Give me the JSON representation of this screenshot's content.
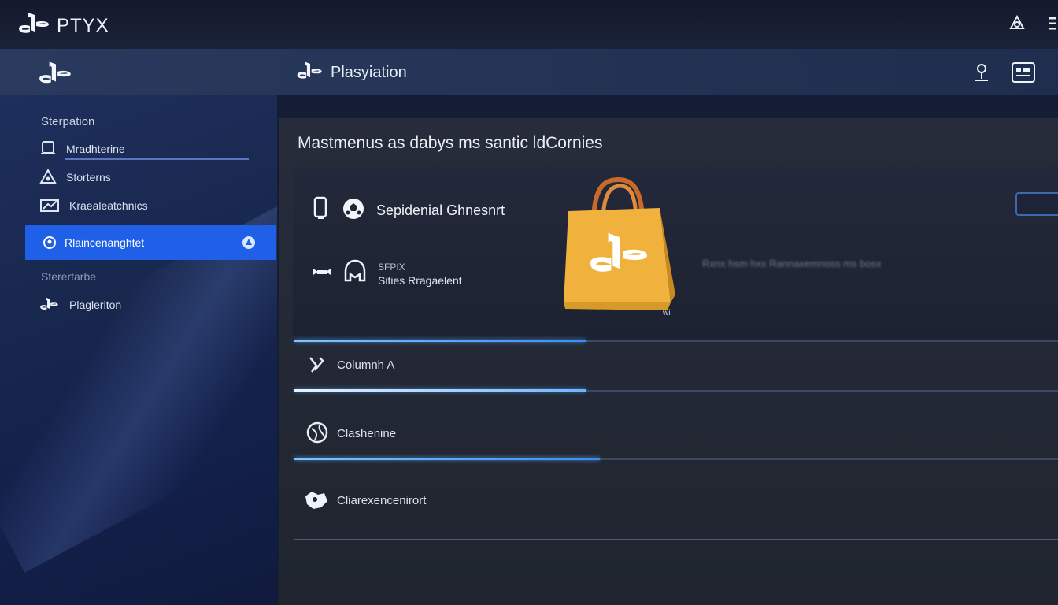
{
  "topbar": {
    "brand": "PTYX"
  },
  "header": {
    "title": "Plasyiation"
  },
  "sidebar": {
    "section1": "Sterpation",
    "items": [
      {
        "label": "Mradhterine",
        "icon": "gamepad-icon"
      },
      {
        "label": "Storterns",
        "icon": "triangle-icon"
      },
      {
        "label": "Kraealeatchnics",
        "icon": "chart-icon"
      }
    ],
    "active_item": {
      "label": "Rlaincenanghtet",
      "icon": "user-icon"
    },
    "section2": "Sterertarbe",
    "bottom_item": {
      "label": "Plagleriton",
      "icon": "playstation-icon"
    }
  },
  "content": {
    "title": "Mastmenus as dabys ms santic ldCornies",
    "panel": {
      "row1": {
        "label": "Sepidenial Ghnesnrt",
        "icon": "soccer-ball-icon"
      },
      "row2": {
        "line1": "SFPIX",
        "line2": "Sities Rragaelent",
        "icon": "helmet-icon"
      },
      "blurred_text": "Rxnx hsm hxx Rannaxemnoss ms bosx",
      "bag_tag": "wi"
    },
    "list": [
      {
        "label": "Columnh A",
        "icon": "tools-icon"
      },
      {
        "label": "Clashenine",
        "icon": "globe-icon"
      },
      {
        "label": "Cliarexencenirort",
        "icon": "puzzle-icon"
      }
    ]
  },
  "colors": {
    "accent": "#2060e8",
    "progress": "#4aa3ff",
    "bag": "#f0b23c"
  }
}
